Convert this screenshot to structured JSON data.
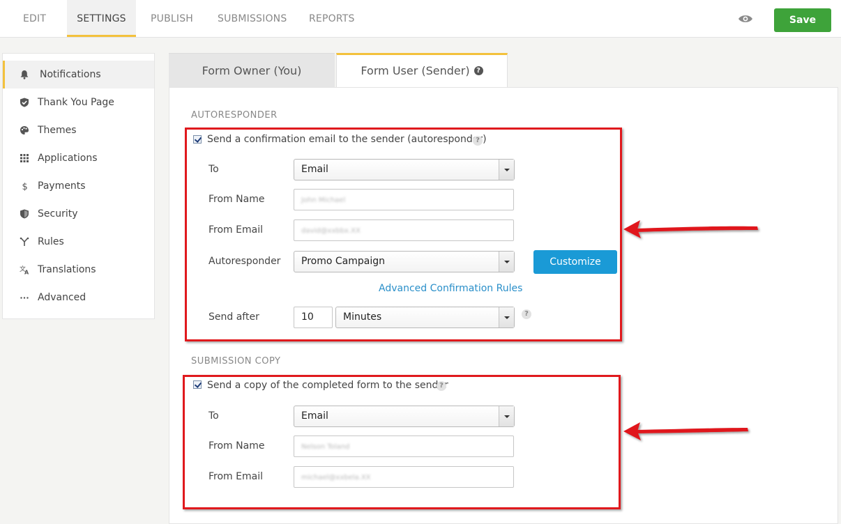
{
  "topnav": {
    "tabs": [
      {
        "label": "EDIT"
      },
      {
        "label": "SETTINGS"
      },
      {
        "label": "PUBLISH"
      },
      {
        "label": "SUBMISSIONS"
      },
      {
        "label": "REPORTS"
      }
    ],
    "active_tab": "SETTINGS",
    "preview_icon": "eye-icon",
    "save_label": "Save"
  },
  "sidebar": {
    "items": [
      {
        "label": "Notifications",
        "icon": "bell-icon"
      },
      {
        "label": "Thank You Page",
        "icon": "shield-check-icon"
      },
      {
        "label": "Themes",
        "icon": "palette-icon"
      },
      {
        "label": "Applications",
        "icon": "grid-icon"
      },
      {
        "label": "Payments",
        "icon": "dollar-icon"
      },
      {
        "label": "Security",
        "icon": "security-shield-icon"
      },
      {
        "label": "Rules",
        "icon": "branch-icon"
      },
      {
        "label": "Translations",
        "icon": "translate-icon"
      },
      {
        "label": "Advanced",
        "icon": "ellipsis-icon"
      }
    ],
    "active_item": "Notifications"
  },
  "content_tabs": {
    "owner_label": "Form Owner (You)",
    "user_label": "Form User (Sender)",
    "help_glyph": "?"
  },
  "autoresponder": {
    "section_title": "AUTORESPONDER",
    "checkbox_label": "Send a confirmation email to the sender (autoresponder)",
    "checked": true,
    "hint_glyph": "?",
    "to_label": "To",
    "to_value": "Email",
    "from_name_label": "From Name",
    "from_name_value": "John Michael",
    "from_email_label": "From Email",
    "from_email_value": "david@xxbbx.XX",
    "autoresponder_label": "Autoresponder",
    "autoresponder_value": "Promo Campaign",
    "customize_label": "Customize",
    "advanced_rules_link": "Advanced Confirmation Rules",
    "send_after_label": "Send after",
    "send_after_value": "10",
    "send_after_unit": "Minutes",
    "send_after_hint": "?"
  },
  "submission_copy": {
    "section_title": "SUBMISSION COPY",
    "checkbox_label": "Send a copy of the completed form to the sender",
    "checked": true,
    "hint_glyph": "?",
    "to_label": "To",
    "to_value": "Email",
    "from_name_label": "From Name",
    "from_name_value": "Nelson Toland",
    "from_email_label": "From Email",
    "from_email_value": "michael@xxbela.XX"
  },
  "colors": {
    "accent_yellow": "#f3c13c",
    "save_green": "#3ea33a",
    "customize_blue": "#1a9ad6",
    "link_blue": "#2a8fc9",
    "annotation_red": "#e0191d"
  }
}
